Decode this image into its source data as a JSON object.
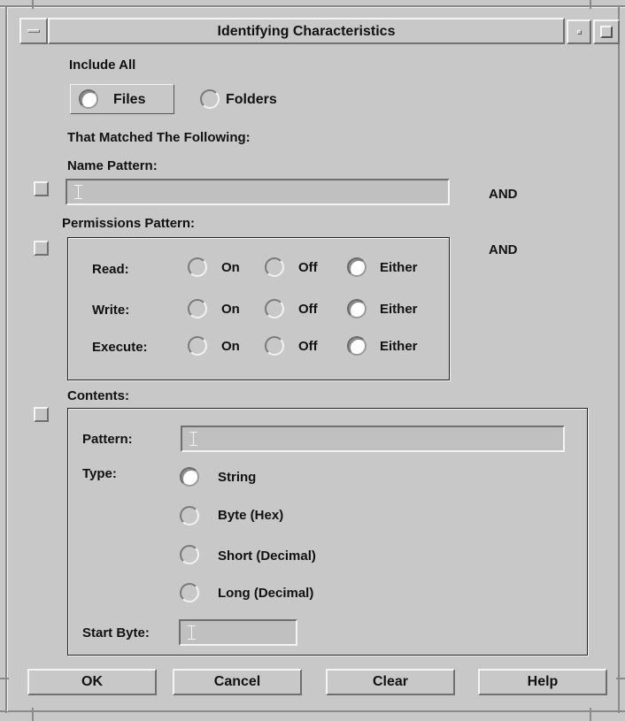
{
  "window": {
    "title": "Identifying Characteristics",
    "menu_icon": "window-menu-icon",
    "minimize_icon": "minimize-icon",
    "maximize_icon": "maximize-icon"
  },
  "include": {
    "heading": "Include All",
    "options": [
      {
        "label": "Files",
        "selected": true
      },
      {
        "label": "Folders",
        "selected": false
      }
    ]
  },
  "matched_heading": "That Matched The Following:",
  "name_pattern": {
    "label": "Name Pattern:",
    "value": "",
    "checked": false,
    "conjunction": "AND"
  },
  "permissions": {
    "label": "Permissions Pattern:",
    "checked": false,
    "conjunction": "AND",
    "option_labels": [
      "On",
      "Off",
      "Either"
    ],
    "rows": [
      {
        "label": "Read:",
        "selected": "Either"
      },
      {
        "label": "Write:",
        "selected": "Either"
      },
      {
        "label": "Execute:",
        "selected": "Either"
      }
    ]
  },
  "contents": {
    "label": "Contents:",
    "checked": false,
    "pattern_label": "Pattern:",
    "pattern_value": "",
    "type_label": "Type:",
    "types": [
      {
        "label": "String",
        "selected": true
      },
      {
        "label": "Byte (Hex)",
        "selected": false
      },
      {
        "label": "Short (Decimal)",
        "selected": false
      },
      {
        "label": "Long (Decimal)",
        "selected": false
      }
    ],
    "start_byte_label": "Start Byte:",
    "start_byte_value": ""
  },
  "buttons": {
    "ok": "OK",
    "cancel": "Cancel",
    "clear": "Clear",
    "help": "Help"
  },
  "colors": {
    "background": "#c8c8c8",
    "highlight": "#f4f4f4",
    "shadow": "#6f6f6f"
  }
}
